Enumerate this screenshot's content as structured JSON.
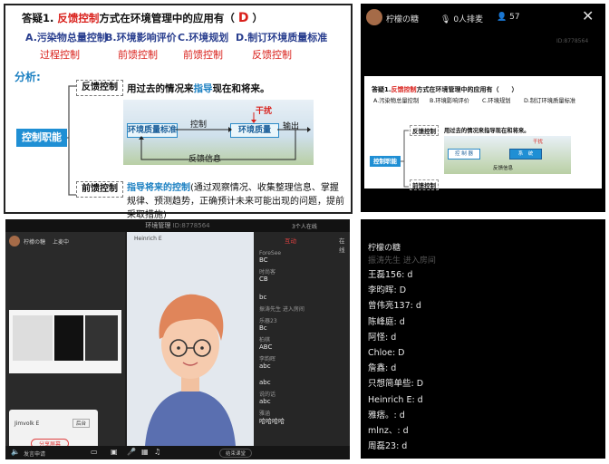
{
  "slide_main": {
    "title_prefix": "答疑1.",
    "title_highlight": "反馈控制",
    "title_suffix": "方式在环境管理中的应用有（",
    "answer": "D",
    "title_close": "）",
    "options": [
      {
        "label": "A.污染物总量控制",
        "note": "过程控制"
      },
      {
        "label": "B.环境影响评价",
        "note": "前馈控制"
      },
      {
        "label": "C.环境规划",
        "note": "前馈控制"
      },
      {
        "label": "D.制订环境质量标准",
        "note": "反馈控制"
      }
    ],
    "analysis_label": "分析:",
    "control_function": "控制职能",
    "feedback_label": "反馈控制",
    "feedback_desc_a": "用过去的情况来",
    "feedback_desc_b": "指导",
    "feedback_desc_c": "现在和将来。",
    "diagram": {
      "standard": "环境质量标准",
      "control": "控制",
      "quality": "环境质量",
      "disturbance": "干扰",
      "output": "输出",
      "feedback_info": "反馈信息"
    },
    "feedforward_label": "前馈控制",
    "feedforward_desc_a": "指导将来的控制",
    "feedforward_desc_b": "(通过观察情况、收集整理信息、掌握规律、预测趋势，正确预计未来可能出现的问题，提前采取措施)"
  },
  "mobile": {
    "username": "柠檬の糖",
    "mic_queue": "0人排麦",
    "viewers": "57",
    "room_id": "ID:8778564",
    "close_icon": "close-icon",
    "small_slide": {
      "title_prefix": "答疑1.",
      "title_highlight": "反馈控制",
      "title_suffix": "方式在环境管理中的应用有（　　）",
      "options": [
        "A.污染物总量控制",
        "B.环境影响评价",
        "C.环境规划",
        "D.制订环境质量标准"
      ],
      "feedback_label": "反馈控制",
      "feedback_desc": "用过去的情况来指导现在和将来。",
      "control_function": "控制职能",
      "feedforward_label": "前馈控制",
      "d_control": "控 制 器",
      "d_system": "系　统",
      "d_disturb": "干扰",
      "d_feedback": "反馈信息"
    }
  },
  "desktop": {
    "window_title": "环境管理",
    "room_id": "ID:8778564",
    "presenter": "柠檬の糖",
    "mic_status": "上麦中",
    "host_label": "3个人在线",
    "video_name": "Heinrich E",
    "chat_tabs": [
      "互动",
      "在线"
    ],
    "chat_messages": [
      {
        "name": "ForeSee",
        "text": "BC"
      },
      {
        "name": "时尚客",
        "text": "CB"
      },
      {
        "name": "",
        "text": "bc"
      },
      {
        "name": "振涛先生 进入房间",
        "text": ""
      },
      {
        "name": "乐器23",
        "text": "Bc"
      },
      {
        "name": "柏棋",
        "text": "ABC"
      },
      {
        "name": "李韵晖",
        "text": "abc"
      },
      {
        "name": "",
        "text": "abc"
      },
      {
        "name": "说的话",
        "text": "abc"
      },
      {
        "name": "雅涵",
        "text": "哈哈哈哈"
      }
    ],
    "share_popup_name": "Jimvolk E",
    "share_popup_btn": "后台",
    "share_popup_action": "分享屏幕",
    "bottom_left": "发言申请",
    "bottom_right": "结束课堂"
  },
  "chat_right": {
    "header": "柠檬の糖",
    "faded_line": "振涛先生 进入房间",
    "lines": [
      "王磊156: d",
      "李昀晖: D",
      "曾伟亮137: d",
      "陈峰庭: d",
      "阿怪: d",
      "Chloe: D",
      "詹鑫: d",
      "只想简单些: D",
      "Heinrich E: d",
      "雅痞。: d",
      "mlnz、: d",
      "周磊23: d"
    ]
  }
}
